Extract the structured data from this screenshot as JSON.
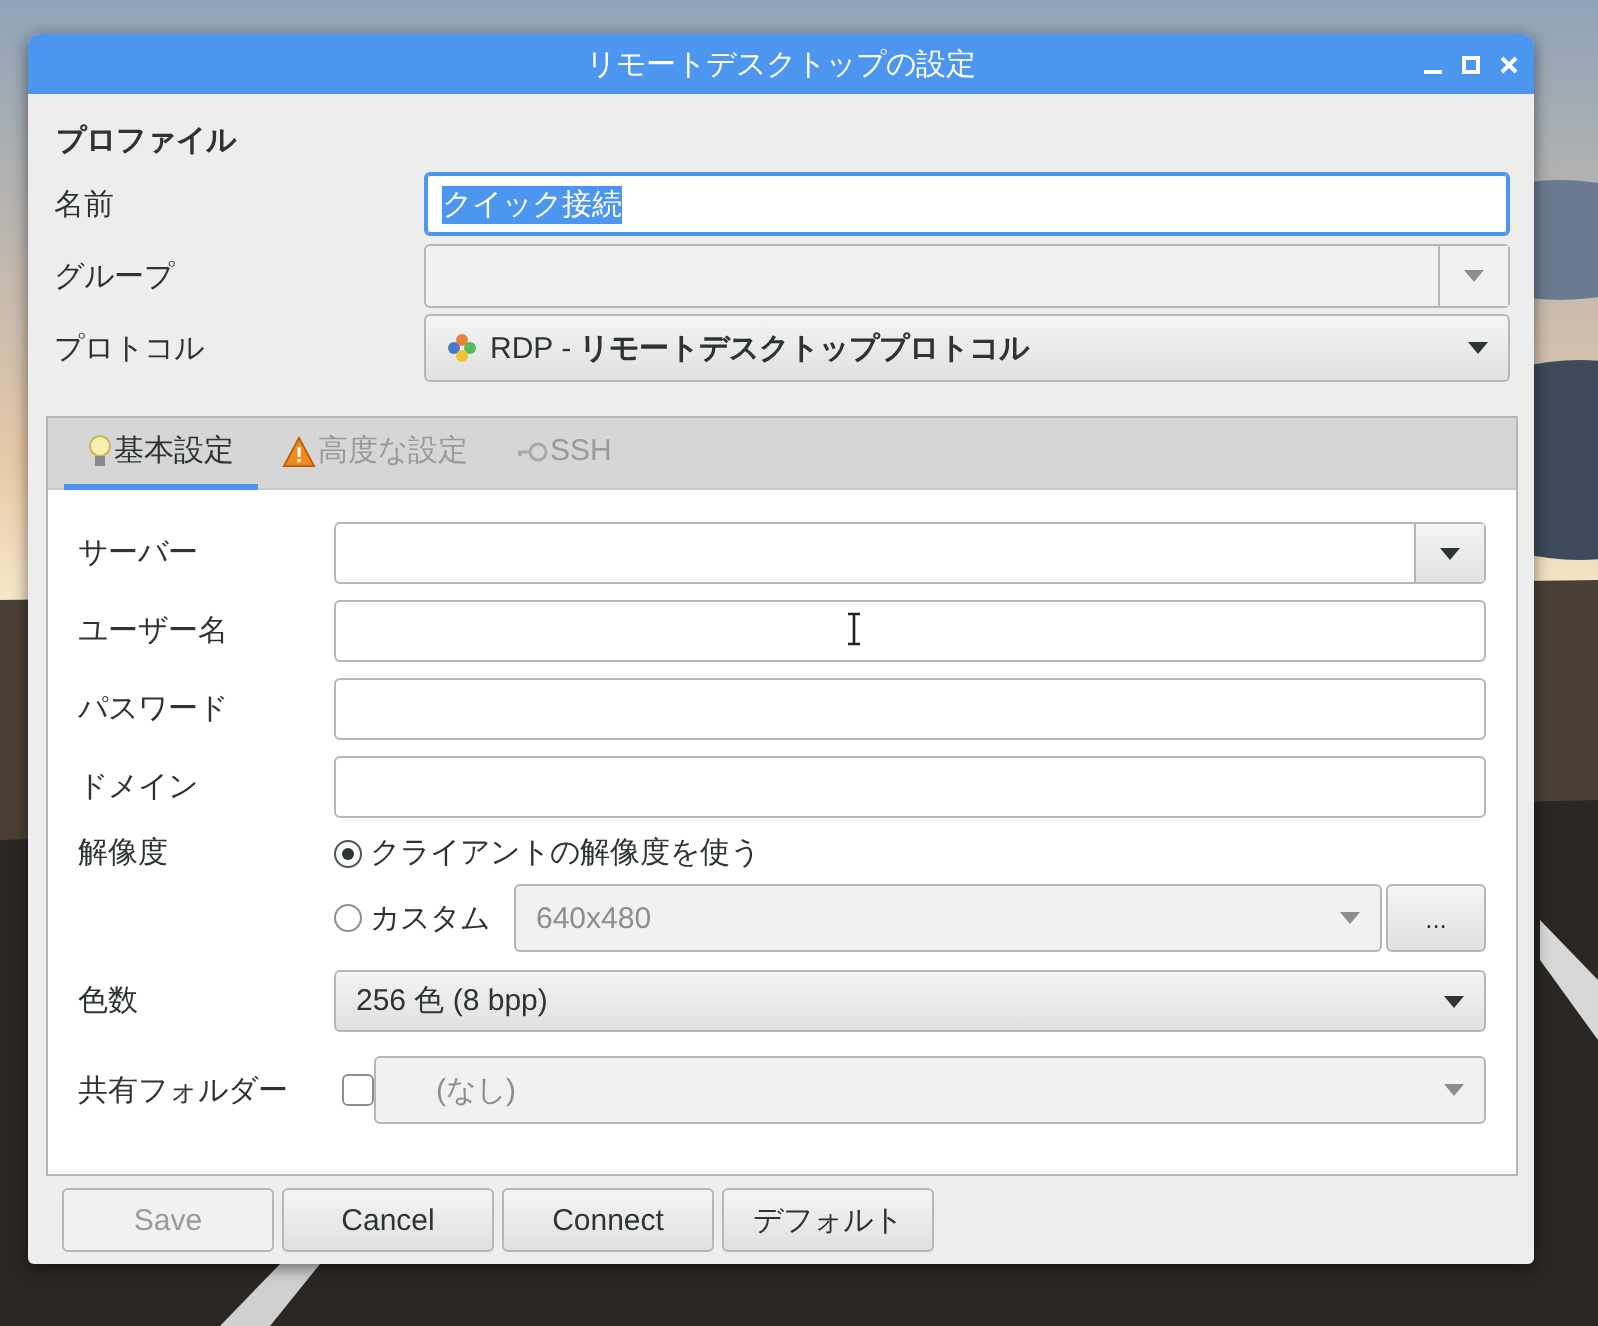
{
  "window": {
    "title": "リモートデスクトップの設定"
  },
  "profile": {
    "heading": "プロファイル",
    "fields": [
      {
        "kind": "text",
        "label": "名前",
        "value": "クイック接続",
        "selected": true
      },
      {
        "kind": "combo",
        "label": "グループ",
        "disabled": true
      },
      {
        "kind": "select",
        "label": "プロトコル",
        "value": "RDP - **リモートデスクトッププロトコル**"
      }
    ]
  },
  "tabs": [
    {
      "label": "基本設定",
      "selected": true,
      "disabled": false
    },
    {
      "label": "高度な設定",
      "selected": false,
      "disabled": true
    },
    {
      "label": "SSH",
      "selected": false,
      "disabled": true
    }
  ],
  "basic": {
    "rows": [
      {
        "kind": "combo",
        "label": "サーバー"
      },
      {
        "kind": "text",
        "label": "ユーザー名"
      },
      {
        "kind": "text",
        "label": "パスワード"
      },
      {
        "kind": "text",
        "label": "ドメイン"
      },
      {
        "kind": "radio",
        "label": "解像度",
        "options": [
          {
            "label": "クライアントの解像度を使う",
            "selected": true
          },
          {
            "label": "カスタム",
            "selected": false,
            "value": "640x480",
            "button": "..."
          }
        ]
      },
      {
        "kind": "select",
        "label": "色数",
        "value": "256 色 (8 bpp)"
      },
      {
        "kind": "check",
        "label": "共有フォルダー",
        "checked": false,
        "value": "(なし)"
      }
    ]
  },
  "buttons": [
    {
      "label": "Save",
      "disabled": true
    },
    {
      "label": "Cancel",
      "disabled": false
    },
    {
      "label": "Connect",
      "disabled": false
    },
    {
      "label": "デフォルト",
      "disabled": false
    }
  ]
}
